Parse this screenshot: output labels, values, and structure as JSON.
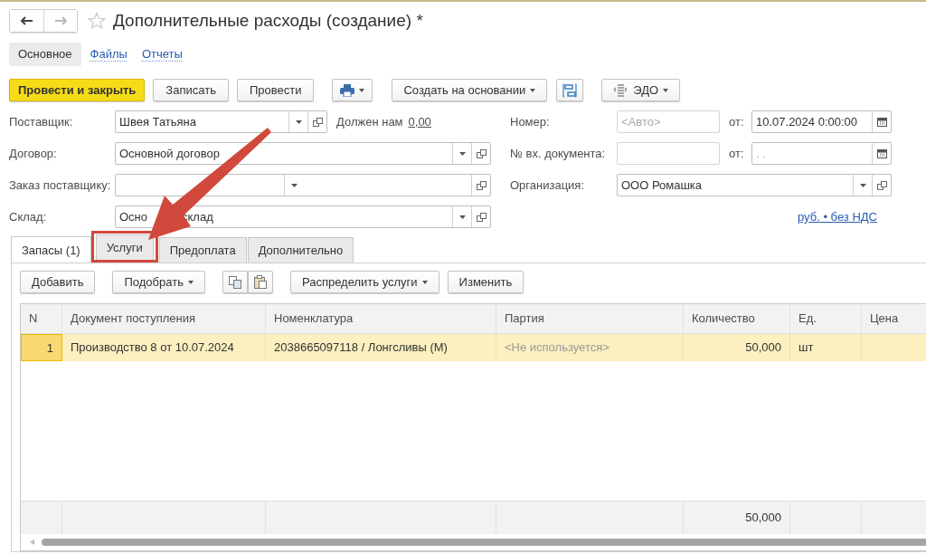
{
  "window": {
    "title": "Дополнительные расходы (создание) *",
    "favorite": false
  },
  "sections": [
    {
      "label": "Основное",
      "selected": true
    },
    {
      "label": "Файлы",
      "selected": false
    },
    {
      "label": "Отчеты",
      "selected": false
    }
  ],
  "toolbar": [
    {
      "kind": "primary",
      "label": "Провести и закрыть"
    },
    {
      "kind": "button",
      "label": "Записать"
    },
    {
      "kind": "button",
      "label": "Провести"
    },
    {
      "kind": "print"
    },
    {
      "kind": "menu",
      "label": "Создать на основании"
    },
    {
      "kind": "structure"
    },
    {
      "kind": "edo",
      "label": "ЭДО"
    }
  ],
  "left_fields": [
    {
      "label": "Поставщик:",
      "value": "Швея Татьяна",
      "kind": "short"
    },
    {
      "label": "Договор:",
      "value": "Основной договор",
      "kind": "long"
    },
    {
      "label": "Заказ поставщику:",
      "kind": "long"
    },
    {
      "label": "Склад:",
      "value_parts": [
        "Осно",
        "склад"
      ],
      "kind": "long"
    }
  ],
  "debt": {
    "label": "Должен нам",
    "value": "0,00"
  },
  "right_fields": [
    {
      "label": "Номер:",
      "placeholder": "<Авто>",
      "date_label": "от:",
      "date": "10.07.2024  0:00:00",
      "kind": "number"
    },
    {
      "label": "№ вх. документа:",
      "date_label": "от:",
      "date_placeholder": ".  .",
      "kind": "number"
    },
    {
      "label": "Организация:",
      "value": "ООО Ромашка",
      "kind": "select"
    }
  ],
  "currency_link": "руб. • без НДС",
  "tabs": [
    {
      "label": "Запасы (1)",
      "selected": true,
      "highlighted": false
    },
    {
      "label": "Услуги",
      "selected": false,
      "highlighted": true
    },
    {
      "label": "Предоплата",
      "selected": false,
      "highlighted": false
    },
    {
      "label": "Дополнительно",
      "selected": false,
      "highlighted": false
    }
  ],
  "table_toolbar": [
    {
      "kind": "button",
      "label": "Добавить"
    },
    {
      "kind": "menu",
      "label": "Подобрать"
    },
    {
      "kind": "copy"
    },
    {
      "kind": "paste"
    },
    {
      "kind": "menu",
      "label": "Распределить услуги"
    },
    {
      "kind": "button",
      "label": "Изменить"
    }
  ],
  "table": {
    "columns": [
      "N",
      "Документ поступления",
      "Номенклатура",
      "Партия",
      "Количество",
      "Ед.",
      "Цена"
    ],
    "rows": [
      {
        "cells": [
          "1",
          "Производство 8 от 10.07.2024",
          "2038665097118  / Лонгсливы (М)",
          "<Не используется>",
          "50,000",
          "шт"
        ],
        "selected": true
      }
    ],
    "totals": {
      "quantity": "50,000"
    }
  }
}
